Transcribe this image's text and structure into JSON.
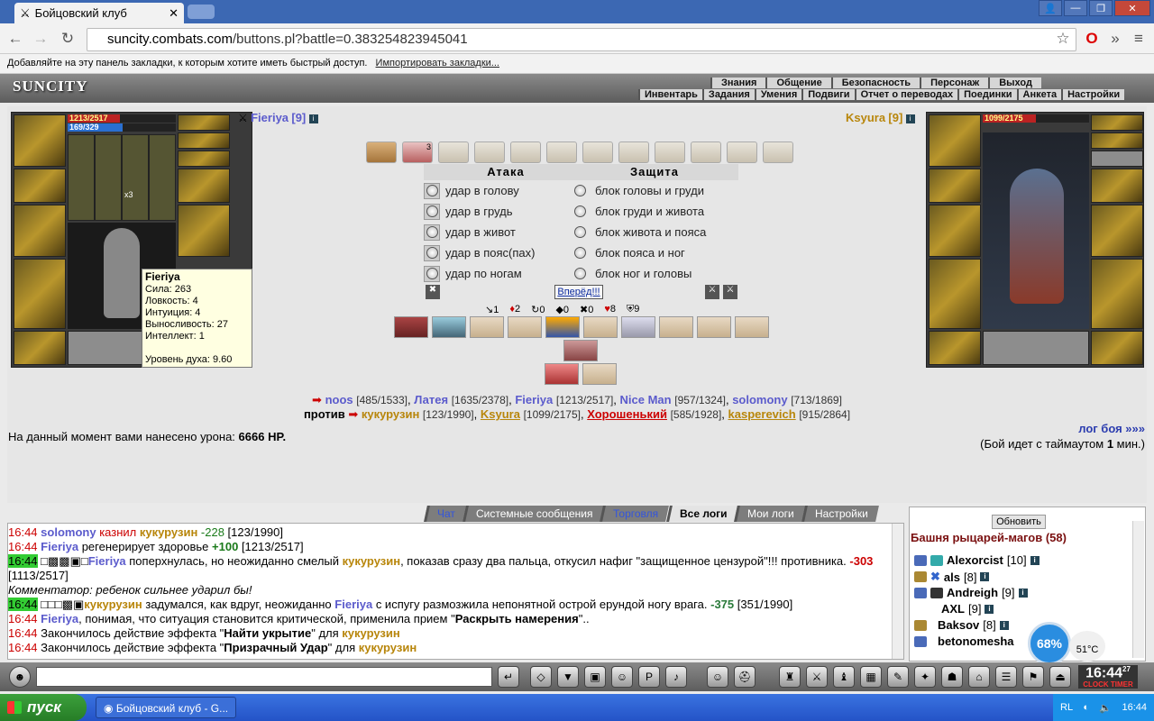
{
  "browser": {
    "tab_title": "Бойцовский клуб",
    "url_host": "suncity.combats.com",
    "url_path": "/buttons.pl?battle=0.383254823945041",
    "bookmarks_hint": "Добавляйте на эту панель закладки, к которым хотите иметь быстрый доступ.",
    "import_link": "Импортировать закладки..."
  },
  "game": {
    "logo": "SUNCITY",
    "menu_top": [
      "Знания",
      "Общение",
      "Безопасность",
      "Персонаж",
      "Выход"
    ],
    "menu_bottom": [
      "Инвентарь",
      "Задания",
      "Умения",
      "Подвиги",
      "Отчет о переводах",
      "Поединки",
      "Анкета",
      "Настройки"
    ]
  },
  "player": {
    "name": "Fieriya",
    "level": "[9]",
    "hp": "1213/2517",
    "mana": "169/329",
    "hp_fraction": 0.48,
    "mana_fraction": 0.51,
    "item_count_label": "x3",
    "tooltip": {
      "name": "Fieriya",
      "str": "Сила: 263",
      "agi": "Ловкость: 4",
      "int": "Интуиция: 4",
      "end": "Выносливость: 27",
      "intel": "Интеллект: 1",
      "spirit": "Уровень духа: 9.60"
    }
  },
  "opponent": {
    "name": "Ksyura",
    "level": "[9]",
    "hp": "1099/2175",
    "hp_fraction": 0.5
  },
  "combat": {
    "attack_title": "Атака",
    "defense_title": "Защита",
    "attacks": [
      "удар в голову",
      "удар в грудь",
      "удар в живот",
      "удар в пояс(пах)",
      "удар по ногам"
    ],
    "defenses": [
      "блок головы и груди",
      "блок груди и живота",
      "блок живота и пояса",
      "блок пояса и ног",
      "блок ног и головы"
    ],
    "go_button": "Вперёд!!!",
    "stats": [
      "1",
      "2",
      "0",
      "0",
      "0",
      "8",
      "9"
    ],
    "scroll_count_label": "3"
  },
  "teams": {
    "team1": [
      {
        "name": "noos",
        "hp": "[485/1533]"
      },
      {
        "name": "Латея",
        "hp": "[1635/2378]"
      },
      {
        "name": "Fieriya",
        "hp": "[1213/2517]"
      },
      {
        "name": "Nice Man",
        "hp": "[957/1324]"
      },
      {
        "name": "solomony",
        "hp": "[713/1869]"
      }
    ],
    "vs": "против",
    "team2": [
      {
        "name": "кукурузин",
        "hp": "[123/1990]"
      },
      {
        "name": "Ksyura",
        "hp": "[1099/2175]"
      },
      {
        "name": "Хорошенький",
        "hp": "[585/1928]"
      },
      {
        "name": "kasperevich",
        "hp": "[915/2864]"
      }
    ]
  },
  "damage": {
    "label": "На данный момент вами нанесено урона:",
    "value": "6666 HP."
  },
  "battle_log_link": "лог боя »»»",
  "timeout_pre": "(Бой идет с таймаутом ",
  "timeout_val": "1",
  "timeout_post": " мин.)",
  "chat_tabs": [
    "Чат",
    "Системные сообщения",
    "Торговля",
    "Все логи",
    "Мои логи",
    "Настройки"
  ],
  "chat_lines": {
    "l1": {
      "time": "16:44",
      "a": "solomony",
      "b": " казнил ",
      "c": "кукурузин",
      "d": " -228",
      "e": " [123/1990]"
    },
    "l2": {
      "time": "16:44",
      "a": "Fieriya",
      "b": " регенерирует здоровье ",
      "c": "+100",
      "d": " [1213/2517]"
    },
    "l3": {
      "time": "16:44",
      "a": "Fieriya",
      "b": " поперхнулась, но неожиданно смелый ",
      "c": "кукурузин",
      "d": ", показав сразу два пальца, откусил нафиг \"защищенное цензурой\"!!! противника. ",
      "e": "-303",
      "f": " [1113/2517]"
    },
    "l4": {
      "text": "Комментатор: ребенок сильнее ударил бы!"
    },
    "l5": {
      "time": "16:44",
      "a": "кукурузин",
      "b": " задумался, как вдруг, неожиданно ",
      "c": "Fieriya",
      "d": " с испугу размозжила непонятной острой ерундой ногу врага. ",
      "e": "-375",
      "f": " [351/1990]"
    },
    "l6": {
      "time": "16:44",
      "a": "Fieriya",
      "b": ", понимая, что ситуация становится критической, применила прием \"",
      "c": "Раскрыть намерения",
      "d": "\".."
    },
    "l7": {
      "time": "16:44",
      "a": "Закончилось действие эффекта \"",
      "b": "Найти укрытие",
      "c": "\" для ",
      "d": "кукурузин"
    },
    "l8": {
      "time": "16:44",
      "a": "Закончилось действие эффекта \"",
      "b": "Призрачный Удар",
      "c": "\" для ",
      "d": "кукурузин"
    }
  },
  "side": {
    "refresh": "Обновить",
    "room": "Башня рыцарей-магов (58)",
    "users": [
      {
        "name": "Alexorcist",
        "lvl": "[10]"
      },
      {
        "name": "als",
        "lvl": "[8]"
      },
      {
        "name": "Andreigh",
        "lvl": "[9]"
      },
      {
        "name": "AXL",
        "lvl": "[9]"
      },
      {
        "name": "Baksov",
        "lvl": "[8]"
      },
      {
        "name": "betonomesha",
        "lvl": ""
      }
    ],
    "gauge": "68%",
    "temp": "51°C"
  },
  "clock": {
    "time": "16:44",
    "sec": "27",
    "label": "CLOCK TIMER"
  },
  "taskbar": {
    "start": "пуск",
    "task": "Бойцовский клуб - G...",
    "lang": "RL",
    "time": "16:44"
  },
  "colors": {
    "accent_blue": "#5b5bcc",
    "accent_gold": "#b8860b",
    "hp_red": "#c00"
  }
}
